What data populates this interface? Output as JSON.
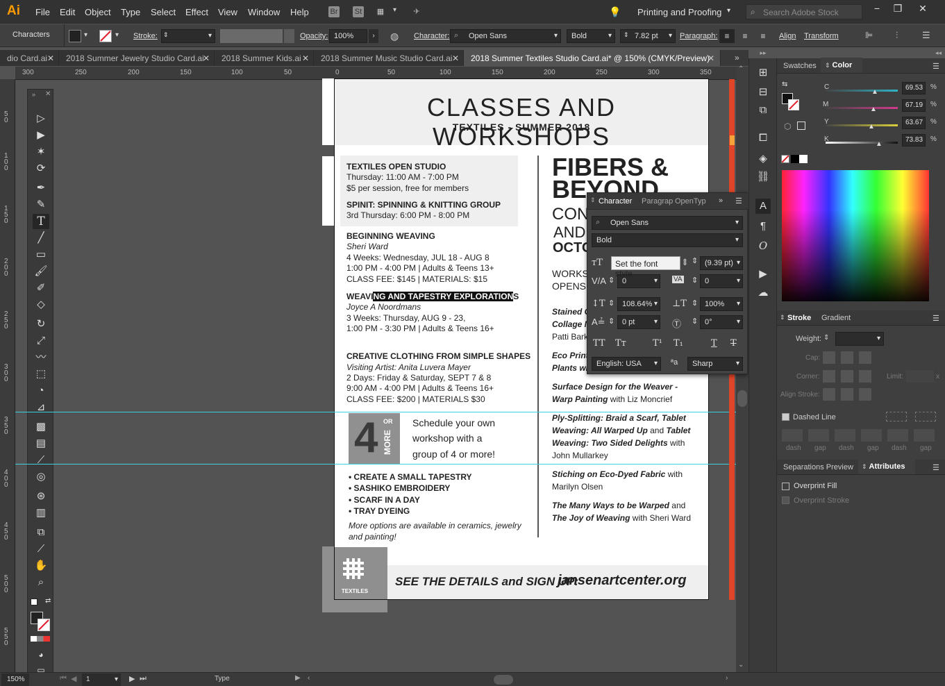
{
  "menubar": {
    "logo": "Ai",
    "items": [
      "File",
      "Edit",
      "Object",
      "Type",
      "Select",
      "Effect",
      "View",
      "Window",
      "Help"
    ],
    "bridge": "Br",
    "stock": "St",
    "workspace": "Printing and Proofing",
    "search_placeholder": "Search Adobe Stock"
  },
  "control": {
    "panel_name": "Characters",
    "stroke_label": "Stroke:",
    "opacity_label": "Opacity:",
    "opacity_value": "100%",
    "character_label": "Character:",
    "font": "Open Sans",
    "style": "Bold",
    "size": "7.82 pt",
    "paragraph_label": "Paragraph:",
    "align_label": "Align",
    "transform_label": "Transform"
  },
  "tabs": [
    {
      "label": "dio Card.ai",
      "active": false
    },
    {
      "label": "2018 Summer Jewelry Studio Card.ai",
      "active": false
    },
    {
      "label": "2018 Summer Kids.ai",
      "active": false
    },
    {
      "label": "2018 Summer Music Studio Card.ai",
      "active": false
    },
    {
      "label": "2018 Summer Textiles Studio Card.ai* @ 150% (CMYK/Preview)",
      "active": true
    }
  ],
  "ruler": {
    "h": [
      "300",
      "250",
      "200",
      "150",
      "100",
      "50",
      "0",
      "50",
      "100",
      "150",
      "200",
      "250",
      "300",
      "350"
    ],
    "v": [
      "5 0",
      "1 0 0",
      "1 5 0",
      "2 0 0",
      "2 5 0",
      "3 0 0",
      "3 5 0",
      "4 0 0",
      "4 5 0",
      "5 0 0",
      "5 5 0"
    ]
  },
  "artboard": {
    "title": "CLASSES AND WORKSHOPS",
    "subtitle": "TEXTILES - SUMMER 2018",
    "open_studio": {
      "title": "TEXTILES OPEN STUDIO",
      "l1": "Thursday: 11:00 AM - 7:00 PM",
      "l2": "$5 per session, free for members"
    },
    "spinit": {
      "title": "SPINIT: SPINNING & KNITTING GROUP",
      "l1": "3rd Thursday: 6:00 PM - 8:00 PM"
    },
    "weaving": {
      "title": "BEGINNING WEAVING",
      "instructor": "Sheri Ward",
      "l1": "4 Weeks: Wednesday, JUL 18 - AUG 8",
      "l2": "1:00 PM - 4:00 PM | Adults & Teens 13+",
      "l3": "CLASS FEE: $145 | MATERIALS: $15"
    },
    "tapestry": {
      "title_pre": "WEAVI",
      "title_sel": "NG AND TAPESTRY EXPLORATION",
      "title_post": "S",
      "instructor": "Joyce A Noordmans",
      "l1": "3 Weeks: Thursday, AUG 9 - 23,",
      "l2": "1:00 PM - 3:30 PM | Adults & Teens 16+"
    },
    "clothing": {
      "title": "CREATIVE CLOTHING FROM SIMPLE SHAPES",
      "instructor": "Visiting Artist: Anita Luvera Mayer",
      "l1": "2 Days: Friday & Saturday, SEPT 7 & 8",
      "l2": "9:00 AM - 4:00 PM | Adults & Teens 16+",
      "l3": "CLASS FEE: $200 | MATERIALS $30"
    },
    "badge": {
      "num": "4",
      "or": "OR",
      "more": "MORE"
    },
    "schedule": {
      "l1": "Schedule your own",
      "l2": "workshop with a",
      "l3": "group of 4 or more!"
    },
    "bullets": [
      "• CREATE A SMALL TAPESTRY",
      "• SASHIKO EMBROIDERY",
      "• SCARF IN A DAY",
      "• TRAY DYEING"
    ],
    "more_opts": {
      "l1": "More options are available in ceramics, jewelry",
      "l2": "and painting!"
    },
    "fibers": {
      "l1": "FIBERS &",
      "l2": "BEYOND",
      "l3": "CON",
      "l4": "AND",
      "l5": "OCTO"
    },
    "workshops": {
      "l1": "WORKS",
      "l2": "OPENS J"
    },
    "list": {
      "a1": "Stained G",
      "a2": "Collage N",
      "a3": "Patti Bark",
      "b1": "Eco Printi",
      "b2": "Plants wi",
      "c1": "Surface Design for the Weaver -",
      "c2": "Warp Painting",
      "c3": " with Liz Moncrief",
      "d1": "Ply-Splitting: Braid a Scarf,  Tablet",
      "d2": "Weaving: All Warped Up",
      "d3": " and ",
      "d4": "Tablet",
      "d5": "Weaving: Two Sided Delights",
      "d6": " with",
      "d7": "John Mullarkey",
      "e1": "Stiching on Eco-Dyed Fabric",
      "e2": " with",
      "e3": "Marilyn Olsen",
      "f1": "The Many Ways to be Warped",
      "f2": " and",
      "f3": "The Joy of Weaving",
      "f4": " with Sheri Ward"
    },
    "footer": {
      "label": "TEXTILES",
      "cta": "SEE THE DETAILS and SIGN UP:",
      "url": "jansenartcenter.org"
    }
  },
  "character_panel": {
    "tabs": [
      "Character",
      "Paragrap",
      "OpenTyp"
    ],
    "font": "Open Sans",
    "style": "Bold",
    "leading": "(9.39 pt)",
    "kerning": "0",
    "tracking": "0",
    "vscale": "108.64%",
    "hscale": "100%",
    "baseline": "0 pt",
    "rotation": "0°",
    "language": "English: USA",
    "antialias": "Sharp",
    "aa_label": "ªa",
    "tooltip": "Set the font style"
  },
  "color_panel": {
    "tabs": [
      "Swatches",
      "Color"
    ],
    "rows": [
      {
        "label": "C",
        "value": "69.53",
        "unit": "%",
        "color": "#2fb3c6",
        "pos": 0.7
      },
      {
        "label": "M",
        "value": "67.19",
        "unit": "%",
        "color": "#d23a8c",
        "pos": 0.67
      },
      {
        "label": "Y",
        "value": "63.67",
        "unit": "%",
        "color": "#d9cf3a",
        "pos": 0.64
      },
      {
        "label": "K",
        "value": "73.83",
        "unit": "%",
        "color": "#888888",
        "pos": 0.74
      }
    ]
  },
  "stroke_panel": {
    "tabs": [
      "Stroke",
      "Gradient"
    ],
    "weight_label": "Weight:",
    "cap_label": "Cap:",
    "corner_label": "Corner:",
    "limit_label": "Limit:",
    "limit_x": "x",
    "align_label": "Align Stroke:",
    "dashed_label": "Dashed Line",
    "dash_labels": [
      "dash",
      "gap",
      "dash",
      "gap",
      "dash",
      "gap"
    ]
  },
  "attributes_panel": {
    "tabs": [
      "Separations Preview",
      "Attributes"
    ],
    "overprint_fill": "Overprint Fill",
    "overprint_stroke": "Overprint Stroke"
  },
  "status": {
    "zoom": "150%",
    "page": "1",
    "tool": "Type"
  }
}
